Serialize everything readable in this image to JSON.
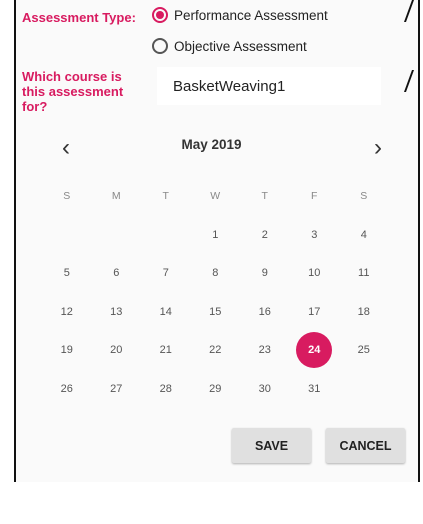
{
  "form": {
    "assessment_type_label": "Assessment Type:",
    "radio_options": [
      {
        "label": "Performance Assessment",
        "checked": true
      },
      {
        "label": "Objective Assessment",
        "checked": false
      }
    ],
    "course_label": "Which course is this assessment for?",
    "course_value": "BasketWeaving1"
  },
  "calendar": {
    "month_title": "May 2019",
    "prev_icon": "chevron-left-icon",
    "next_icon": "chevron-right-icon",
    "prev_glyph": "‹",
    "next_glyph": "›",
    "weekdays": [
      "S",
      "M",
      "T",
      "W",
      "T",
      "F",
      "S"
    ],
    "weeks": [
      [
        "",
        "",
        "",
        "1",
        "2",
        "3",
        "4"
      ],
      [
        "5",
        "6",
        "7",
        "8",
        "9",
        "10",
        "11"
      ],
      [
        "12",
        "13",
        "14",
        "15",
        "16",
        "17",
        "18"
      ],
      [
        "19",
        "20",
        "21",
        "22",
        "23",
        "24",
        "25"
      ],
      [
        "26",
        "27",
        "28",
        "29",
        "30",
        "31",
        ""
      ]
    ],
    "selected_day": "24"
  },
  "actions": {
    "save_label": "SAVE",
    "cancel_label": "CANCEL"
  },
  "colors": {
    "accent": "#d81b60",
    "dialog_bg": "#fafafa",
    "button_bg": "#e0e0e0"
  }
}
